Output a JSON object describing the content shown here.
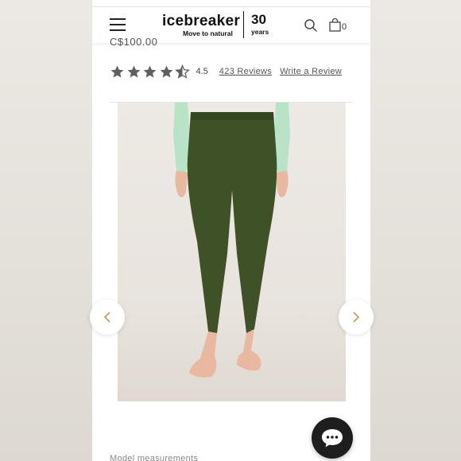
{
  "header": {
    "brand_name": "icebreaker",
    "brand_tagline": "Move to natural",
    "anniversary_number": "30",
    "anniversary_label": "years",
    "cart_count": "0"
  },
  "product": {
    "price_partial": "C$100.00",
    "rating_value": "4.5",
    "stars_filled_fraction": 0.9,
    "reviews_link": "423 Reviews",
    "write_review_link": "Write a Review"
  },
  "gallery": {
    "image_subject": "model wearing green leggings",
    "leggings_color": "#3e5127",
    "top_color": "#b8e3c6"
  },
  "details": {
    "section_partial": "Model measurements"
  },
  "icons": {
    "menu": "hamburger-icon",
    "search": "search-icon",
    "cart": "shopping-bag-icon",
    "prev": "chevron-left-icon",
    "next": "chevron-right-icon",
    "chat": "chat-bubble-icon"
  }
}
